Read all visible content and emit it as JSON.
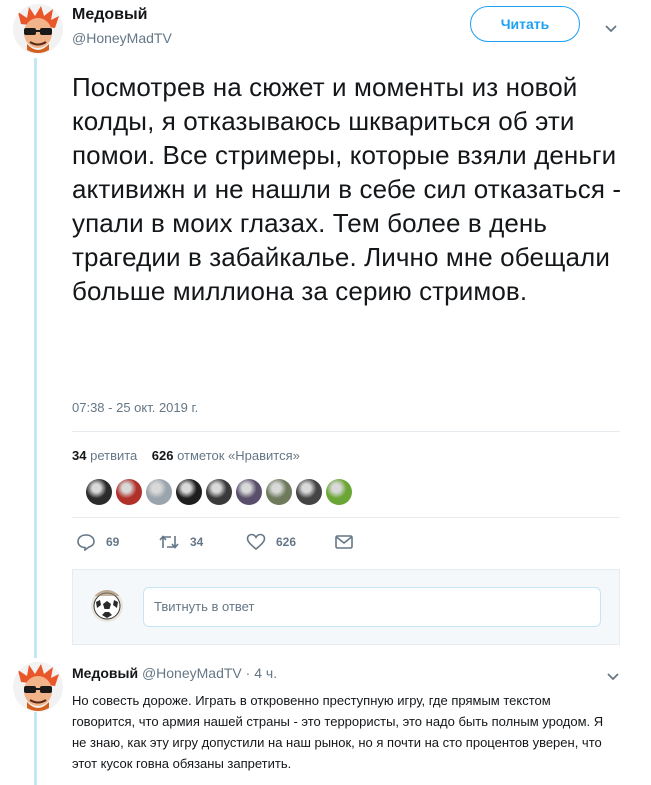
{
  "header": {
    "display_name": "Медовый",
    "handle": "@HoneyMadTV",
    "follow_label": "Читать"
  },
  "tweet": {
    "text": "Посмотрев на сюжет и моменты из новой колды, я отказываюсь шквариться об эти помои. Все стримеры, которые взяли деньги активижн и не нашли в себе сил отказаться - упали в моих глазах. Тем более в день трагедии в забайкалье. Лично мне обещали больше миллиона за серию стримов.",
    "timestamp": "07:38 - 25 окт. 2019 г."
  },
  "stats": {
    "retweets_count": "34",
    "retweets_label": "ретвита",
    "likes_count": "626",
    "likes_label": "отметок «Нравится»"
  },
  "actions": {
    "replies": "69",
    "retweets": "34",
    "likes": "626"
  },
  "reply_box": {
    "placeholder": "Твитнуть в ответ"
  },
  "reply": {
    "display_name": "Медовый",
    "handle": "@HoneyMadTV",
    "separator": " · ",
    "time": "4 ч.",
    "text": "Но совесть дороже. Играть в откровенно преступную игру, где прямым текстом говорится, что армия нашей страны - это террористы, это надо быть полным уродом. Я не знаю, как эту игру допустили на наш рынок, но я почти на сто процентов уверен, что этот кусок говна обязаны запретить."
  },
  "colors": {
    "accent": "#1da1f2",
    "muted": "#657786",
    "thread_line": "#c4e6f5"
  },
  "likers": [
    "#2b2b2b",
    "#b0302a",
    "#9aa4ad",
    "#1e1e1e",
    "#3a3a3a",
    "#5a4f6a",
    "#6d7a5c",
    "#444444",
    "#6aa535"
  ]
}
